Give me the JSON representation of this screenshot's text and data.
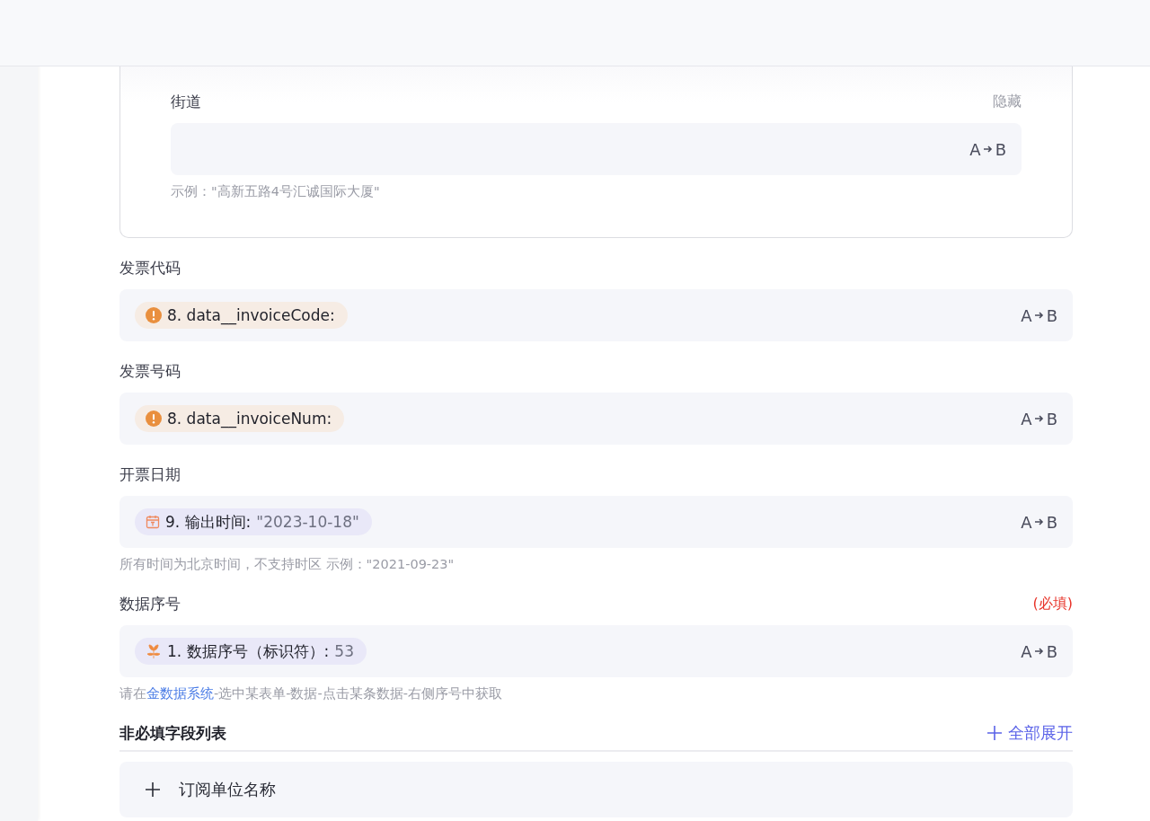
{
  "address_card": {
    "fields": [
      {
        "label": "街道",
        "tag": {
          "kind": "hidden",
          "text": "隐藏"
        },
        "convert": {
          "from": "A",
          "to": "B"
        },
        "hint": {
          "before": "示例：\"高新五路4号汇诚国际大厦\""
        }
      }
    ]
  },
  "fields": [
    {
      "label": "发票代码",
      "token": {
        "kind": "warning",
        "name": "8. data__invoiceCode:"
      },
      "convert": {
        "from": "A",
        "to": "B"
      }
    },
    {
      "label": "发票号码",
      "token": {
        "kind": "warning",
        "name": "8. data__invoiceNum:"
      },
      "convert": {
        "from": "A",
        "to": "B"
      }
    },
    {
      "label": "开票日期",
      "token": {
        "kind": "date",
        "name": "9. 输出时间:",
        "value": "\"2023-10-18\""
      },
      "convert": {
        "from": "A",
        "to": "B"
      },
      "hint": {
        "before": "所有时间为北京时间，不支持时区 示例：\"2021-09-23\""
      }
    },
    {
      "label": "数据序号",
      "tag": {
        "kind": "required",
        "text": "(必填)"
      },
      "token": {
        "kind": "serial",
        "name": "1. 数据序号（标识符）:",
        "value": "53"
      },
      "convert": {
        "from": "A",
        "to": "B"
      },
      "hint": {
        "before": "请在",
        "link": "金数据系统",
        "after": "-选中某表单-数据-点击某条数据-右侧序号中获取"
      }
    }
  ],
  "optional_section": {
    "title": "非必填字段列表",
    "expand_all": "全部展开",
    "items": [
      {
        "label": "订阅单位名称"
      }
    ]
  }
}
